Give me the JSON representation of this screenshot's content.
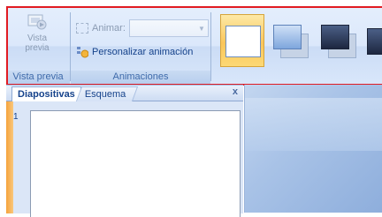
{
  "ribbon": {
    "preview_group": {
      "button_label_line1": "Vista",
      "button_label_line2": "previa",
      "group_label": "Vista previa"
    },
    "animations_group": {
      "animate_label": "Animar:",
      "animate_value": "",
      "custom_animation_label": "Personalizar animación",
      "group_label": "Animaciones"
    },
    "transitions_gallery": {
      "items": [
        "transition-none",
        "transition-fade",
        "transition-fade-black",
        "transition-cut"
      ],
      "selected_index": 0
    }
  },
  "slides_pane": {
    "tab_slides": "Diapositivas",
    "tab_outline": "Esquema",
    "close_label": "x",
    "slide_number": "1"
  },
  "colors": {
    "highlight": "#e11b22",
    "selection": "#fbc65a"
  }
}
